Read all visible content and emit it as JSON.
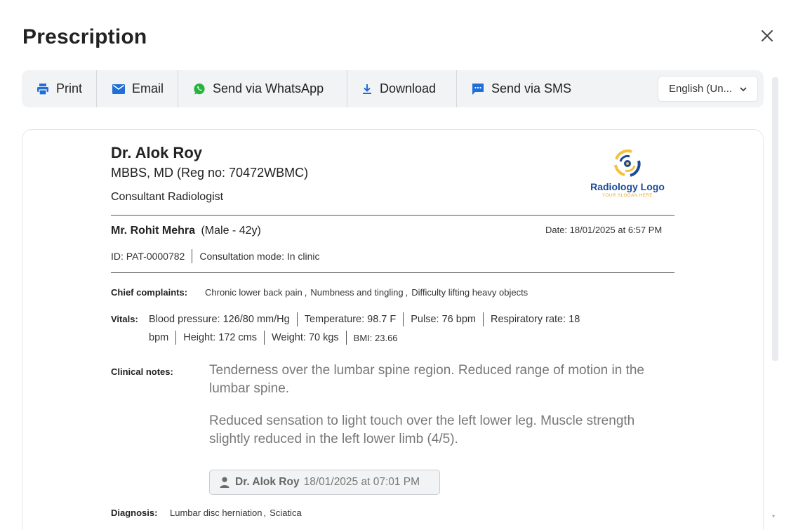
{
  "modal": {
    "title": "Prescription"
  },
  "toolbar": {
    "print": "Print",
    "email": "Email",
    "whatsapp": "Send via WhatsApp",
    "download": "Download",
    "sms": "Send via SMS",
    "language": "English (Un..."
  },
  "doctor": {
    "name": "Dr. Alok Roy",
    "qualification": "MBBS, MD (Reg no: 70472WBMC)",
    "role": "Consultant Radiologist"
  },
  "logo": {
    "text": "Radiology Logo",
    "slogan": "YOUR SLOGAN HERE"
  },
  "patient": {
    "name": "Mr. Rohit Mehra",
    "details": "(Male - 42y)",
    "date": "Date: 18/01/2025 at 6:57 PM",
    "id": "ID: PAT-0000782",
    "mode": "Consultation mode: In clinic"
  },
  "chief": {
    "label": "Chief complaints:",
    "items": [
      "Chronic lower back pain",
      "Numbness and tingling",
      "Difficulty lifting heavy objects"
    ]
  },
  "vitals": {
    "label": "Vitals:",
    "bp": "Blood pressure: 126/80 mm/Hg",
    "temp": "Temperature: 98.7 F",
    "pulse": "Pulse: 76 bpm",
    "resp_a": "Respiratory rate: 18",
    "resp_b": "bpm",
    "height": "Height: 172 cms",
    "weight": "Weight: 70 kgs",
    "bmi": "BMI: 23.66"
  },
  "notes": {
    "label": "Clinical notes:",
    "p1": "Tenderness over the lumbar spine region. Reduced range of motion in the lumbar spine.",
    "p2": "Reduced sensation to light touch over the left lower leg. Muscle strength slightly reduced in the left lower limb (4/5).",
    "author": "Dr. Alok Roy",
    "timestamp": "18/01/2025 at 07:01 PM"
  },
  "diagnosis": {
    "label": "Diagnosis:",
    "items": [
      "Lumbar disc herniation",
      "Sciatica"
    ]
  }
}
